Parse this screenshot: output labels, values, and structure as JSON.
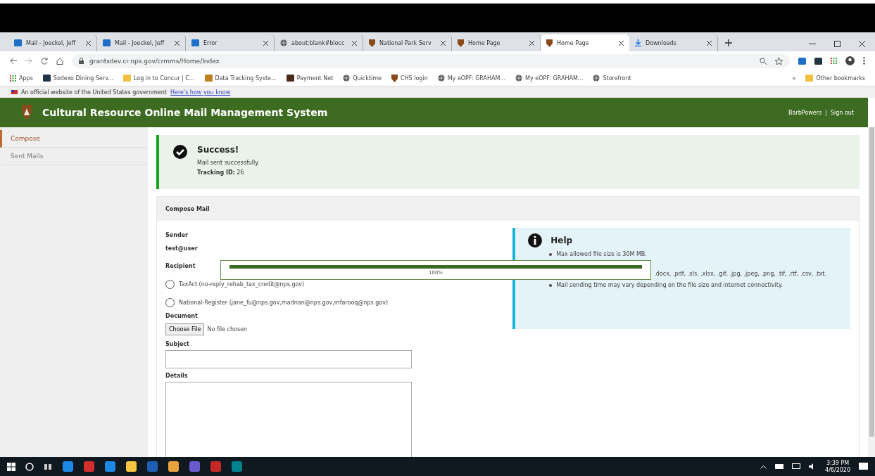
{
  "browser": {
    "tabs": [
      {
        "label": "Mail - Joeckel, Jeff",
        "selected": false
      },
      {
        "label": "Mail - Joeckel, Jeff",
        "selected": false
      },
      {
        "label": "Error",
        "selected": false
      },
      {
        "label": "about:blank#blocc",
        "selected": false
      },
      {
        "label": "National Park Serv",
        "selected": false
      },
      {
        "label": "Home Page",
        "selected": false
      },
      {
        "label": "Home Page",
        "selected": true
      },
      {
        "label": "Downloads",
        "selected": false
      }
    ],
    "url": "grantsdev.cr.nps.gov/crmms/Home/Index",
    "bookmarks": [
      "Apps",
      "Sodexo Dining Serv...",
      "Log in to Concur | C...",
      "Data Tracking Syste...",
      "Payment Net",
      "Quicktime",
      "CHS login",
      "My eOPF: GRAHAM...",
      "My eOPF: GRAHAM...",
      "Storefront"
    ],
    "more": "»",
    "other_bookmarks": "Other bookmarks"
  },
  "gov_banner": {
    "text": "An official website of the United States government",
    "link": "Here's how you know"
  },
  "header": {
    "title": "Cultural Resource Online Mail Management System",
    "user": "BarbPowers",
    "separator": "|",
    "sign_out": "Sign out"
  },
  "sidebar": {
    "items": [
      {
        "label": "Compose",
        "selected": true
      },
      {
        "label": "Sent Mails",
        "selected": false
      }
    ]
  },
  "alert": {
    "title": "Success!",
    "message": "Mail sent successfully.",
    "tracking": "**Tracking ID:** 26"
  },
  "compose": {
    "title": "Compose Mail",
    "sender_label": "Sender",
    "sender": "test@user",
    "recipient_label": "Recipient",
    "recipients": [
      {
        "label": "TaxAct (no-reply_rehab_tax_credit@nps.gov)",
        "selected": false
      },
      {
        "label": "National-Register (jane_fu@nps.gov,madnan@nps.gov,mfarooq@nps.gov)",
        "selected": false
      }
    ],
    "document_label": "Document",
    "file_button": "Choose File",
    "file_status": "No file chosen",
    "subject_label": "Subject",
    "details_label": "Details"
  },
  "help": {
    "title": "Help",
    "bullets": [
      "Max allowed file size is 30M MB.",
      ".docx, .pdf, .xls, .xlsx, .gif, .jpg, .jpeg, .png, .tif, .rtf, .csv, .txt.",
      "Mail sending time may vary depending on the file size and internet connectivity."
    ]
  },
  "upload": {
    "level": 1,
    "reading": "100%"
  },
  "taskbar": {
    "time": "3:39 PM",
    "date": "4/6/2020"
  }
}
